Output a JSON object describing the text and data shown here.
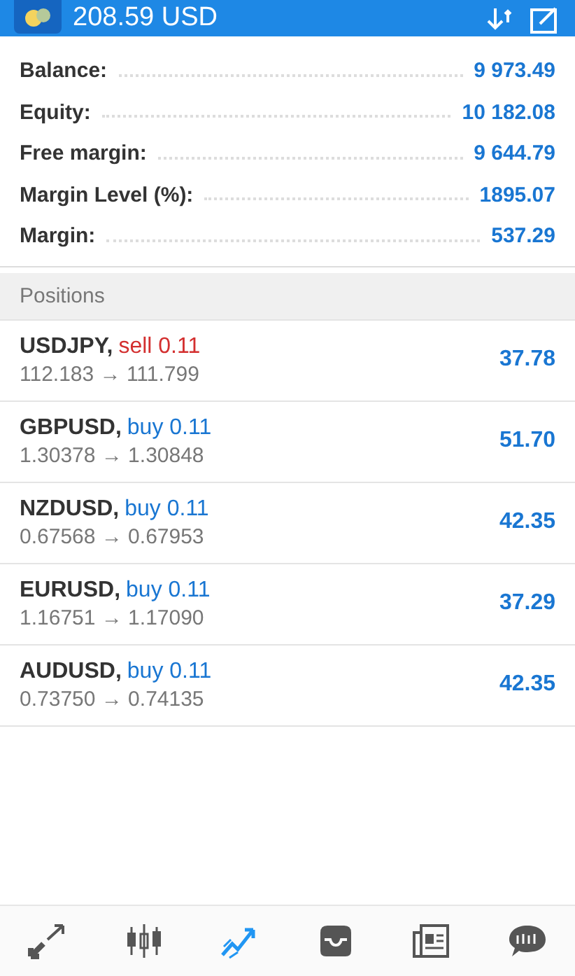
{
  "top_bar": {
    "balance_title": "208.59 USD"
  },
  "summary": [
    {
      "label": "Balance:",
      "value": "9 973.49"
    },
    {
      "label": "Equity:",
      "value": "10 182.08"
    },
    {
      "label": "Free margin:",
      "value": "9 644.79"
    },
    {
      "label": "Margin Level (%):",
      "value": "1895.07"
    },
    {
      "label": "Margin:",
      "value": "537.29"
    }
  ],
  "positions_header": "Positions",
  "positions": [
    {
      "symbol": "USDJPY,",
      "kind": "sell",
      "order": "sell 0.11",
      "prices": "112.183 → 111.799",
      "profit": "37.78"
    },
    {
      "symbol": "GBPUSD,",
      "kind": "buy",
      "order": "buy 0.11",
      "prices": "1.30378 → 1.30848",
      "profit": "51.70"
    },
    {
      "symbol": "NZDUSD,",
      "kind": "buy",
      "order": "buy 0.11",
      "prices": "0.67568 → 0.67953",
      "profit": "42.35"
    },
    {
      "symbol": "EURUSD,",
      "kind": "buy",
      "order": "buy 0.11",
      "prices": "1.16751 → 1.17090",
      "profit": "37.29"
    },
    {
      "symbol": "AUDUSD,",
      "kind": "buy",
      "order": "buy 0.11",
      "prices": "0.73750 → 0.74135",
      "profit": "42.35"
    }
  ],
  "bottom_nav": [
    {
      "kind": "quotes",
      "selected": false
    },
    {
      "kind": "charts",
      "selected": false
    },
    {
      "kind": "trade",
      "selected": true
    },
    {
      "kind": "history",
      "selected": false
    },
    {
      "kind": "news",
      "selected": false
    },
    {
      "kind": "chat",
      "selected": false
    }
  ]
}
